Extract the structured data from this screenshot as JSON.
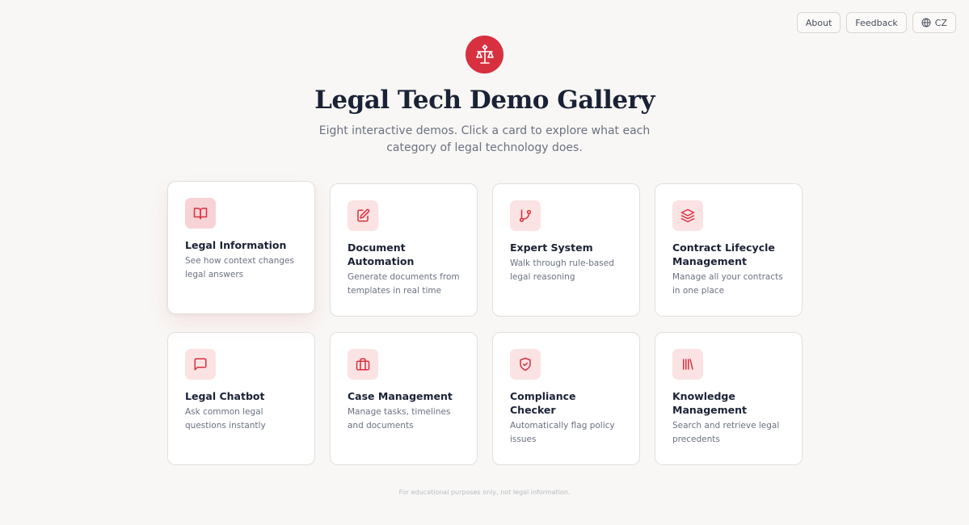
{
  "nav": {
    "about_label": "About",
    "feedback_label": "Feedback",
    "language_label": "CZ"
  },
  "header": {
    "logo_icon": "scales-of-justice-icon",
    "title": "Legal Tech Demo Gallery",
    "subtitle": "Eight interactive demos. Click a card to explore what each category of legal technology does."
  },
  "cards": [
    {
      "title": "Legal Information",
      "desc": "See how context changes legal answers",
      "icon": "book-open-icon"
    },
    {
      "title": "Document Automation",
      "desc": "Generate documents from templates in real time",
      "icon": "edit-document-icon"
    },
    {
      "title": "Expert System",
      "desc": "Walk through rule-based legal reasoning",
      "icon": "git-branch-icon"
    },
    {
      "title": "Contract Lifecycle Management",
      "desc": "Manage all your contracts in one place",
      "icon": "layers-icon"
    },
    {
      "title": "Legal Chatbot",
      "desc": "Ask common legal questions instantly",
      "icon": "message-square-icon"
    },
    {
      "title": "Case Management",
      "desc": "Manage tasks, timelines and documents",
      "icon": "briefcase-icon"
    },
    {
      "title": "Compliance Checker",
      "desc": "Automatically flag policy issues",
      "icon": "shield-check-icon"
    },
    {
      "title": "Knowledge Management",
      "desc": "Search and retrieve legal precedents",
      "icon": "library-icon"
    }
  ],
  "footer": {
    "text": "For educational purposes only, not legal information."
  },
  "colors": {
    "accent": "#d7303f",
    "icon_tile_bg": "#fbe3e3",
    "background": "#f8f7f5",
    "text_primary": "#1a2236",
    "text_secondary": "#6a7181"
  }
}
